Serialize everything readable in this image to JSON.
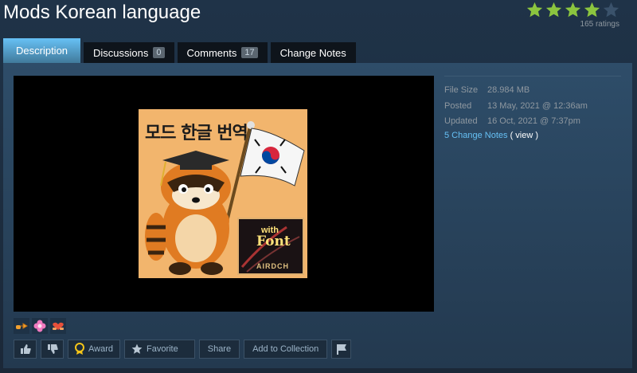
{
  "title": "Mods Korean language",
  "rating": {
    "stars_filled": 4,
    "stars_total": 5,
    "count_text": "165 ratings"
  },
  "tabs": [
    {
      "label": "Description",
      "active": true
    },
    {
      "label": "Discussions",
      "count": "0"
    },
    {
      "label": "Comments",
      "count": "17"
    },
    {
      "label": "Change Notes"
    }
  ],
  "preview_image": {
    "title_text": "모드 한글 번역",
    "badge_with": "with",
    "badge_font": "Font",
    "badge_author": "AIRDCH"
  },
  "meta": {
    "file_size_label": "File Size",
    "file_size": "28.984 MB",
    "posted_label": "Posted",
    "posted": "13 May, 2021 @ 12:36am",
    "updated_label": "Updated",
    "updated": "16 Oct, 2021 @ 7:37pm",
    "change_notes_link": "5 Change Notes",
    "view_link": "( view )"
  },
  "actions": {
    "award": "Award",
    "favorite": "Favorite",
    "share": "Share",
    "add_to_collection": "Add to Collection"
  },
  "icons": [
    "thumbs-up-icon",
    "thumbs-down-icon",
    "award-icon",
    "star-icon",
    "flag-icon"
  ],
  "colors": {
    "accent": "#67c1f5",
    "star_filled": "#8bc53f",
    "link": "#66c0f4"
  }
}
